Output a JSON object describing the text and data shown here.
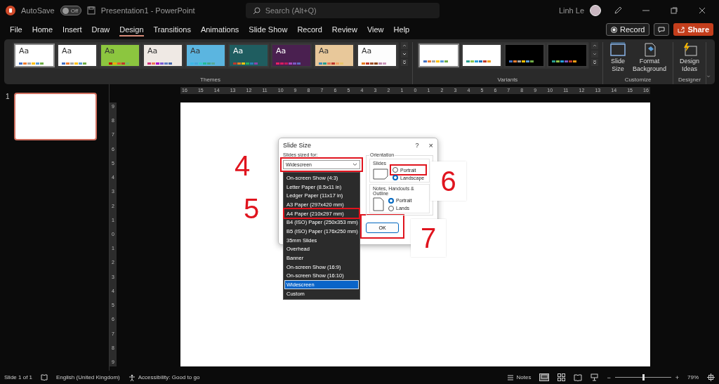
{
  "title_bar": {
    "autosave_label": "AutoSave",
    "autosave": {
      "on": false,
      "label": "Off"
    },
    "document_title": "Presentation1  -  PowerPoint",
    "search": {
      "placeholder": "Search (Alt+Q)"
    },
    "user_name": "Linh Le"
  },
  "tabs": [
    {
      "label": "File",
      "selected": false
    },
    {
      "label": "Home",
      "selected": false
    },
    {
      "label": "Insert",
      "selected": false
    },
    {
      "label": "Draw",
      "selected": false
    },
    {
      "label": "Design",
      "selected": true
    },
    {
      "label": "Transitions",
      "selected": false
    },
    {
      "label": "Animations",
      "selected": false
    },
    {
      "label": "Slide Show",
      "selected": false
    },
    {
      "label": "Record",
      "selected": false
    },
    {
      "label": "Review",
      "selected": false
    },
    {
      "label": "View",
      "selected": false
    },
    {
      "label": "Help",
      "selected": false
    }
  ],
  "header_buttons": {
    "record": "Record",
    "share": "Share"
  },
  "ribbon": {
    "themes": {
      "label": "Themes",
      "items": [
        {
          "label": "Aa",
          "color": "#ffffff",
          "selected": true
        },
        {
          "label": "Aa",
          "color": "#ffffff",
          "selected": false
        },
        {
          "label": "Aa",
          "color": "#8cc63f",
          "selected": false
        },
        {
          "label": "Aa",
          "color": "#efe9e4",
          "selected": false
        },
        {
          "label": "Aa",
          "color": "#5bb5e0",
          "selected": false
        },
        {
          "label": "Aa",
          "color": "#1f5d60",
          "selected": false
        },
        {
          "label": "Aa",
          "color": "#4a2050",
          "selected": false
        },
        {
          "label": "Aa",
          "color": "#e8c89a",
          "selected": false
        },
        {
          "label": "Aa",
          "color": "#fdfdfd",
          "selected": false
        }
      ]
    },
    "variants": {
      "label": "Variants",
      "items": [
        {
          "color": "#ffffff",
          "selected": true
        },
        {
          "color": "#ffffff",
          "selected": false
        },
        {
          "color": "#000000",
          "selected": false
        },
        {
          "color": "#000000",
          "selected": false
        }
      ]
    },
    "customize": {
      "label": "Customize",
      "buttons": [
        {
          "kind": "slide_size",
          "lines": [
            "Slide",
            "Size"
          ]
        },
        {
          "kind": "format_background",
          "lines": [
            "Format",
            "Background"
          ]
        }
      ]
    },
    "designer": {
      "label": "Designer",
      "buttons": [
        {
          "kind": "design_ideas",
          "lines": [
            "Design",
            "Ideas"
          ]
        }
      ]
    }
  },
  "slide_pane": {
    "slides": [
      {
        "number": "1",
        "selected": true
      }
    ]
  },
  "horizontal_ruler": [
    "16",
    "15",
    "14",
    "13",
    "12",
    "11",
    "10",
    "9",
    "8",
    "7",
    "6",
    "5",
    "4",
    "3",
    "2",
    "1",
    "0",
    "1",
    "2",
    "3",
    "4",
    "5",
    "6",
    "7",
    "8",
    "9",
    "10",
    "11",
    "12",
    "13",
    "14",
    "15",
    "16"
  ],
  "vertical_ruler": [
    "9",
    "8",
    "7",
    "6",
    "5",
    "4",
    "3",
    "2",
    "1",
    "0",
    "1",
    "2",
    "3",
    "4",
    "5",
    "6",
    "7",
    "8",
    "9"
  ],
  "dialog": {
    "sized_for_highlighted": true,
    "ok_highlighted": true,
    "title": "Slide Size",
    "help": "?",
    "close": "×",
    "sized_for_label": "Slides sized for:",
    "sized_for_value": "Widescreen",
    "orientation_label": "Orientation",
    "slides_group": {
      "label": "Slides",
      "options": [
        {
          "label": "Portrait",
          "selected": false,
          "highlighted": true
        },
        {
          "label": "Landscape",
          "selected": true,
          "highlighted": false
        }
      ]
    },
    "notes_group": {
      "label": "Notes, Handouts & Outline",
      "options": [
        {
          "label": "Portrait",
          "selected": true,
          "highlighted": false
        },
        {
          "label": "Lands",
          "selected": false,
          "highlighted": false
        }
      ]
    },
    "ok": "OK",
    "dropdown": [
      {
        "label": "On-screen Show (4:3)",
        "selected": false,
        "highlighted": false
      },
      {
        "label": "Letter Paper (8.5x11 in)",
        "selected": false,
        "highlighted": false
      },
      {
        "label": "Ledger Paper (11x17 in)",
        "selected": false,
        "highlighted": false
      },
      {
        "label": "A3 Paper (297x420 mm)",
        "selected": false,
        "highlighted": false
      },
      {
        "label": "A4 Paper (210x297 mm)",
        "selected": false,
        "highlighted": true
      },
      {
        "label": "B4 (ISO) Paper (250x353 mm)",
        "selected": false,
        "highlighted": false
      },
      {
        "label": "B5 (ISO) Paper (176x250 mm)",
        "selected": false,
        "highlighted": false
      },
      {
        "label": "35mm Slides",
        "selected": false,
        "highlighted": false
      },
      {
        "label": "Overhead",
        "selected": false,
        "highlighted": false
      },
      {
        "label": "Banner",
        "selected": false,
        "highlighted": false
      },
      {
        "label": "On-screen Show (16:9)",
        "selected": false,
        "highlighted": false
      },
      {
        "label": "On-screen Show (16:10)",
        "selected": false,
        "highlighted": false
      },
      {
        "label": "Widescreen",
        "selected": true,
        "highlighted": false
      },
      {
        "label": "Custom",
        "selected": false,
        "highlighted": false
      }
    ]
  },
  "annotations": [
    {
      "label": "4",
      "boxed": false
    },
    {
      "label": "5",
      "boxed": false
    },
    {
      "label": "6",
      "boxed": true
    },
    {
      "label": "7",
      "boxed": true
    }
  ],
  "status_bar": {
    "slide_info": "Slide 1 of 1",
    "language": "English (United Kingdom)",
    "accessibility": "Accessibility: Good to go",
    "notes": "Notes",
    "zoom_out": "−",
    "zoom_in": "+",
    "zoom": {
      "level": 0.5
    },
    "zoom_label": "79%"
  }
}
